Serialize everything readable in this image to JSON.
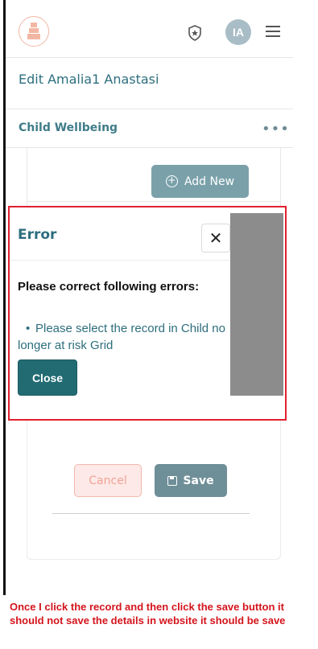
{
  "header": {
    "avatar_initials": "IA",
    "icons": [
      "logo-icon",
      "shield-star-icon",
      "hamburger-menu-icon"
    ]
  },
  "page": {
    "title": "Edit Amalia1 Anastasi"
  },
  "section": {
    "title": "Child Wellbeing",
    "more_label": "•••"
  },
  "buttons": {
    "add_new": "Add New",
    "cancel": "Cancel",
    "save": "Save"
  },
  "modal": {
    "title": "Error",
    "close_x": "✕",
    "heading": "Please correct following errors:",
    "errors": [
      "Please select the record in Child no longer at risk Grid"
    ],
    "close_button": "Close"
  },
  "annotation": {
    "text": "Once I click the record and then click the save button it should not save the details in website it should be save"
  },
  "colors": {
    "brand_teal": "#2d6e7e",
    "highlight_red": "#e0202e",
    "cancel_bg": "#fde9e7",
    "save_bg": "#6f8f98"
  }
}
